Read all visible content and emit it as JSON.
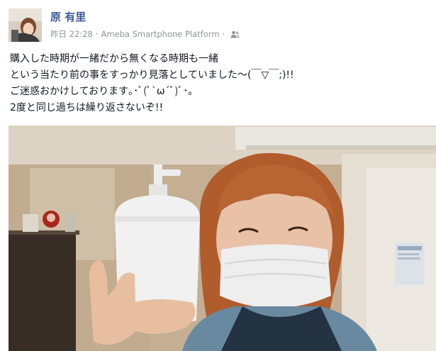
{
  "post": {
    "author_name": "原 有里",
    "timestamp": "昨日 22:28",
    "separator": "·",
    "source": "Ameba Smartphone Platform",
    "privacy_icon": "friends-icon",
    "text_lines": [
      "購入した時期が一緒だから無くなる時期も一緒",
      "という当たり前の事をすっかり見落としていました〜(￣▽￣;)!!",
      "ご迷惑おかけしております｡･ﾟ(ﾟ`ω´ﾟ)ﾟ･｡",
      "2度と同じ過ちは繰り返さないぞ!!"
    ]
  },
  "colors": {
    "author_link": "#3b5998",
    "meta_gray": "#90949c",
    "text": "#141823"
  }
}
